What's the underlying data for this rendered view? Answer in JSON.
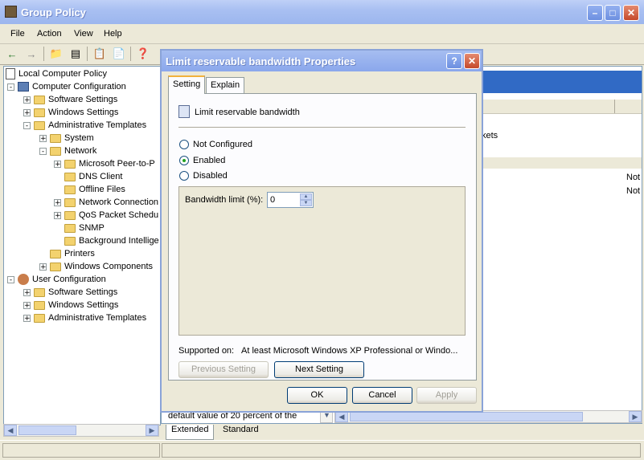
{
  "window": {
    "title": "Group Policy"
  },
  "menu": [
    "File",
    "Action",
    "View",
    "Help"
  ],
  "tree": {
    "items": [
      {
        "label": "Local Computer Policy",
        "icon": "policy-icon",
        "level": 0,
        "expander": ""
      },
      {
        "label": "Computer Configuration",
        "icon": "computer-icon",
        "level": 1,
        "expander": "-"
      },
      {
        "label": "Software Settings",
        "icon": "folder-icon",
        "level": 2,
        "expander": "+"
      },
      {
        "label": "Windows Settings",
        "icon": "folder-icon",
        "level": 2,
        "expander": "+"
      },
      {
        "label": "Administrative Templates",
        "icon": "folder-icon",
        "level": 2,
        "expander": "-"
      },
      {
        "label": "System",
        "icon": "folder-icon",
        "level": 3,
        "expander": "+"
      },
      {
        "label": "Network",
        "icon": "folder-icon",
        "level": 3,
        "expander": "-"
      },
      {
        "label": "Microsoft Peer-to-P",
        "icon": "folder-icon",
        "level": 4,
        "expander": "+"
      },
      {
        "label": "DNS Client",
        "icon": "folder-icon",
        "level": 4,
        "expander": ""
      },
      {
        "label": "Offline Files",
        "icon": "folder-icon",
        "level": 4,
        "expander": ""
      },
      {
        "label": "Network Connection",
        "icon": "folder-icon",
        "level": 4,
        "expander": "+"
      },
      {
        "label": "QoS Packet Schedu",
        "icon": "folder-icon",
        "level": 4,
        "expander": "+"
      },
      {
        "label": "SNMP",
        "icon": "folder-icon",
        "level": 4,
        "expander": ""
      },
      {
        "label": "Background Intellige",
        "icon": "folder-icon",
        "level": 4,
        "expander": ""
      },
      {
        "label": "Printers",
        "icon": "folder-icon",
        "level": 3,
        "expander": ""
      },
      {
        "label": "Windows Components",
        "icon": "folder-icon",
        "level": 3,
        "expander": "+"
      },
      {
        "label": "User Configuration",
        "icon": "user-icon",
        "level": 1,
        "expander": "-"
      },
      {
        "label": "Software Settings",
        "icon": "folder-icon",
        "level": 2,
        "expander": "+"
      },
      {
        "label": "Windows Settings",
        "icon": "folder-icon",
        "level": 2,
        "expander": "+"
      },
      {
        "label": "Administrative Templates",
        "icon": "folder-icon",
        "level": 2,
        "expander": "+"
      }
    ]
  },
  "right_pane": {
    "text_fragment": "kets",
    "state_1": "Not",
    "state_2": "Not",
    "description_fragment": "default value of 20 percent of the"
  },
  "bottom_tabs": [
    "Extended",
    "Standard"
  ],
  "dialog": {
    "title": "Limit reservable bandwidth Properties",
    "tabs": [
      "Setting",
      "Explain"
    ],
    "policy_name": "Limit reservable bandwidth",
    "options": [
      {
        "label": "Not Configured",
        "selected": false
      },
      {
        "label": "Enabled",
        "selected": true
      },
      {
        "label": "Disabled",
        "selected": false
      }
    ],
    "bandwidth_label": "Bandwidth limit (%):",
    "bandwidth_value": "0",
    "supported_label": "Supported on:",
    "supported_value": "At least Microsoft Windows XP Professional or Windo...",
    "prev_button": "Previous Setting",
    "next_button": "Next Setting",
    "ok_button": "OK",
    "cancel_button": "Cancel",
    "apply_button": "Apply"
  },
  "colors": {
    "title_blue": "#8aa7ec",
    "selection_blue": "#316ac5",
    "dialog_bg": "#ece9d8"
  }
}
